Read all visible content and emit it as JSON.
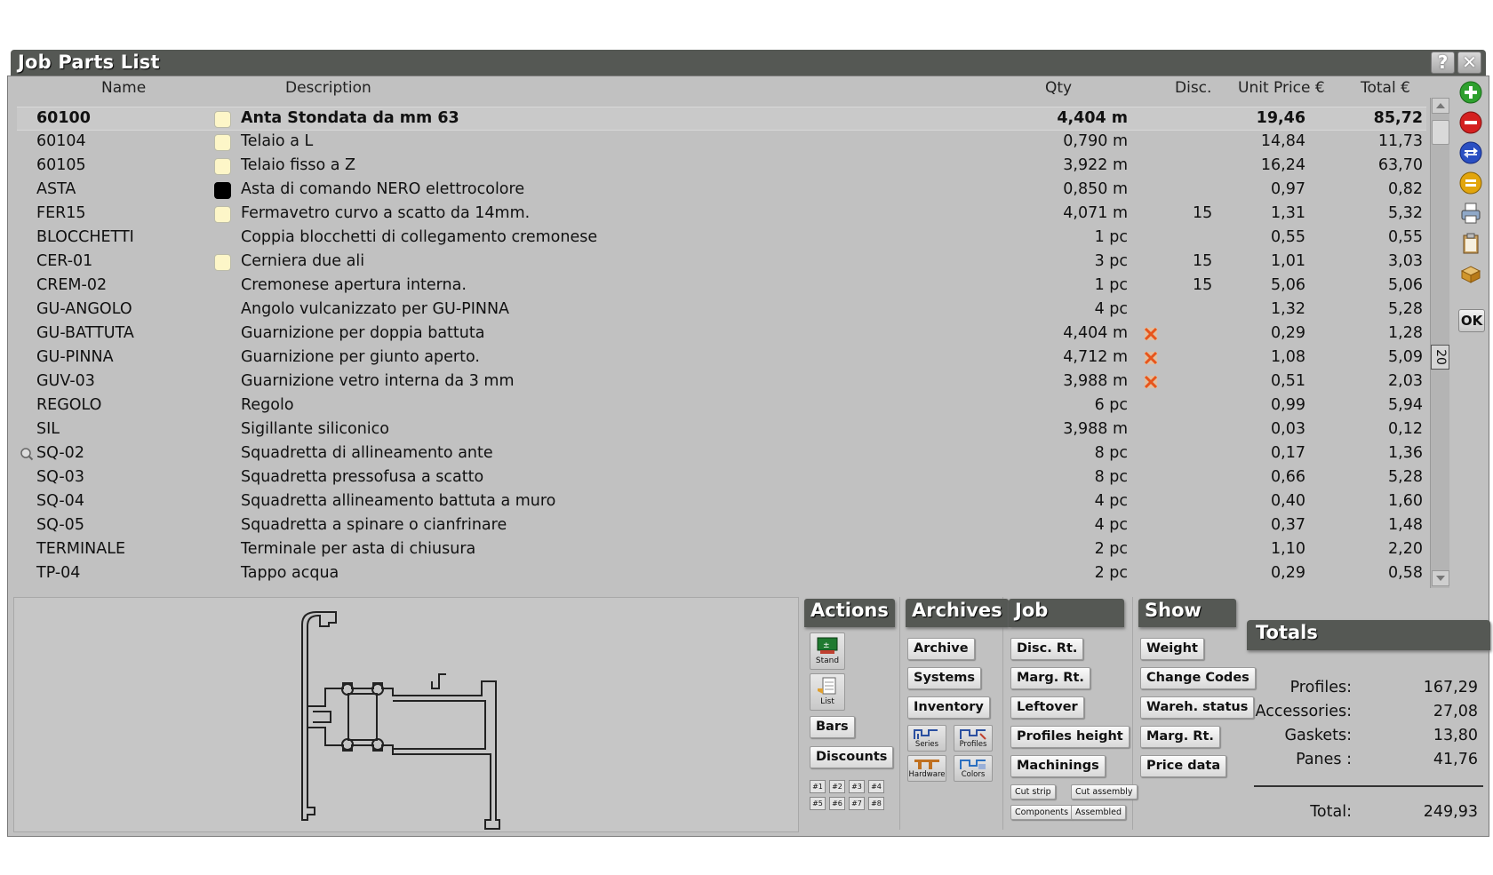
{
  "window": {
    "title": "Job Parts List",
    "help_label": "?",
    "close_label": "✕"
  },
  "columns": {
    "name": "Name",
    "description": "Description",
    "qty": "Qty",
    "disc": "Disc.",
    "unit_price": "Unit Price €",
    "total": "Total €"
  },
  "rows": [
    {
      "name": "60100",
      "desc": "Anta Stondata da mm 63",
      "qty": "4,404 m",
      "disc": "",
      "unit": "19,46",
      "total": "85,72",
      "swatch": "cream",
      "mark": false,
      "selected": true
    },
    {
      "name": "60104",
      "desc": "Telaio a L",
      "qty": "0,790 m",
      "disc": "",
      "unit": "14,84",
      "total": "11,73",
      "swatch": "cream",
      "mark": false
    },
    {
      "name": "60105",
      "desc": "Telaio fisso a Z",
      "qty": "3,922 m",
      "disc": "",
      "unit": "16,24",
      "total": "63,70",
      "swatch": "cream",
      "mark": false
    },
    {
      "name": "ASTA",
      "desc": "Asta di comando NERO elettrocolore",
      "qty": "0,850 m",
      "disc": "",
      "unit": "0,97",
      "total": "0,82",
      "swatch": "black",
      "mark": false
    },
    {
      "name": "FER15",
      "desc": "Fermavetro curvo a scatto da 14mm.",
      "qty": "4,071 m",
      "disc": "15",
      "unit": "1,31",
      "total": "5,32",
      "swatch": "cream",
      "mark": false
    },
    {
      "name": "BLOCCHETTI",
      "desc": "Coppia blocchetti di collegamento cremonese",
      "qty": "1 pc",
      "disc": "",
      "unit": "0,55",
      "total": "0,55",
      "swatch": "",
      "mark": false
    },
    {
      "name": "CER-01",
      "desc": "Cerniera due ali",
      "qty": "3 pc",
      "disc": "15",
      "unit": "1,01",
      "total": "3,03",
      "swatch": "cream",
      "mark": false
    },
    {
      "name": "CREM-02",
      "desc": "Cremonese apertura interna.",
      "qty": "1 pc",
      "disc": "15",
      "unit": "5,06",
      "total": "5,06",
      "swatch": "",
      "mark": false
    },
    {
      "name": "GU-ANGOLO",
      "desc": "Angolo vulcanizzato per GU-PINNA",
      "qty": "4 pc",
      "disc": "",
      "unit": "1,32",
      "total": "5,28",
      "swatch": "",
      "mark": false
    },
    {
      "name": "GU-BATTUTA",
      "desc": "Guarnizione per doppia battuta",
      "qty": "4,404 m",
      "disc": "",
      "unit": "0,29",
      "total": "1,28",
      "swatch": "",
      "mark": true
    },
    {
      "name": "GU-PINNA",
      "desc": "Guarnizione per giunto aperto.",
      "qty": "4,712 m",
      "disc": "",
      "unit": "1,08",
      "total": "5,09",
      "swatch": "",
      "mark": true
    },
    {
      "name": "GUV-03",
      "desc": "Guarnizione vetro interna da 3 mm",
      "qty": "3,988 m",
      "disc": "",
      "unit": "0,51",
      "total": "2,03",
      "swatch": "",
      "mark": true
    },
    {
      "name": "REGOLO",
      "desc": "Regolo",
      "qty": "6 pc",
      "disc": "",
      "unit": "0,99",
      "total": "5,94",
      "swatch": "",
      "mark": false
    },
    {
      "name": "SIL",
      "desc": "Sigillante siliconico",
      "qty": "3,988 m",
      "disc": "",
      "unit": "0,03",
      "total": "0,12",
      "swatch": "",
      "mark": false
    },
    {
      "name": "SQ-02",
      "desc": "Squadretta di allineamento ante",
      "qty": "8 pc",
      "disc": "",
      "unit": "0,17",
      "total": "1,36",
      "swatch": "",
      "mark": false,
      "lens": true
    },
    {
      "name": "SQ-03",
      "desc": "Squadretta pressofusa a scatto",
      "qty": "8 pc",
      "disc": "",
      "unit": "0,66",
      "total": "5,28",
      "swatch": "",
      "mark": false
    },
    {
      "name": "SQ-04",
      "desc": "Squadretta allineamento battuta a muro",
      "qty": "4 pc",
      "disc": "",
      "unit": "0,40",
      "total": "1,60",
      "swatch": "",
      "mark": false
    },
    {
      "name": "SQ-05",
      "desc": "Squadretta a spinare o cianfrinare",
      "qty": "4 pc",
      "disc": "",
      "unit": "0,37",
      "total": "1,48",
      "swatch": "",
      "mark": false
    },
    {
      "name": "TERMINALE",
      "desc": "Terminale per asta di chiusura",
      "qty": "2 pc",
      "disc": "",
      "unit": "1,10",
      "total": "2,20",
      "swatch": "",
      "mark": false
    },
    {
      "name": "TP-04",
      "desc": "Tappo acqua",
      "qty": "2 pc",
      "disc": "",
      "unit": "0,29",
      "total": "0,58",
      "swatch": "",
      "mark": false
    }
  ],
  "scroll_count": "20",
  "ok_label": "OK",
  "panels": {
    "actions": {
      "title": "Actions",
      "stand": "Stand",
      "list": "List",
      "bars": "Bars",
      "discounts": "Discounts",
      "hashes": [
        "#1",
        "#2",
        "#3",
        "#4",
        "#5",
        "#6",
        "#7",
        "#8"
      ]
    },
    "archives": {
      "title": "Archives",
      "archive": "Archive",
      "systems": "Systems",
      "inventory": "Inventory",
      "series": "Series",
      "profiles": "Profiles",
      "hardware": "Hardware",
      "colors": "Colors"
    },
    "job": {
      "title": "Job",
      "disc_rt": "Disc. Rt.",
      "marg_rt": "Marg. Rt.",
      "leftover": "Leftover",
      "profiles_height": "Profiles height",
      "machinings": "Machinings",
      "cutstrip": "Cut strip",
      "cutassembly": "Cut assembly",
      "components": "Components",
      "assembled": "Assembled"
    },
    "show": {
      "title": "Show",
      "weight": "Weight",
      "change_codes": "Change Codes",
      "wareh_status": "Wareh. status",
      "marg_rt": "Marg. Rt.",
      "price_data": "Price data"
    }
  },
  "totals": {
    "title": "Totals",
    "profiles_label": "Profiles:",
    "profiles": "167,29",
    "accessories_label": "Accessories:",
    "accessories": "27,08",
    "gaskets_label": "Gaskets:",
    "gaskets": "13,80",
    "panes_label": "Panes :",
    "panes": "41,76",
    "total_label": "Total:",
    "total": "249,93"
  },
  "colors": {
    "titlebar": "#555854",
    "window_bg": "#c1c1c1",
    "cream_swatch": "#fdf6c8",
    "mark_red": "#e8541a"
  }
}
